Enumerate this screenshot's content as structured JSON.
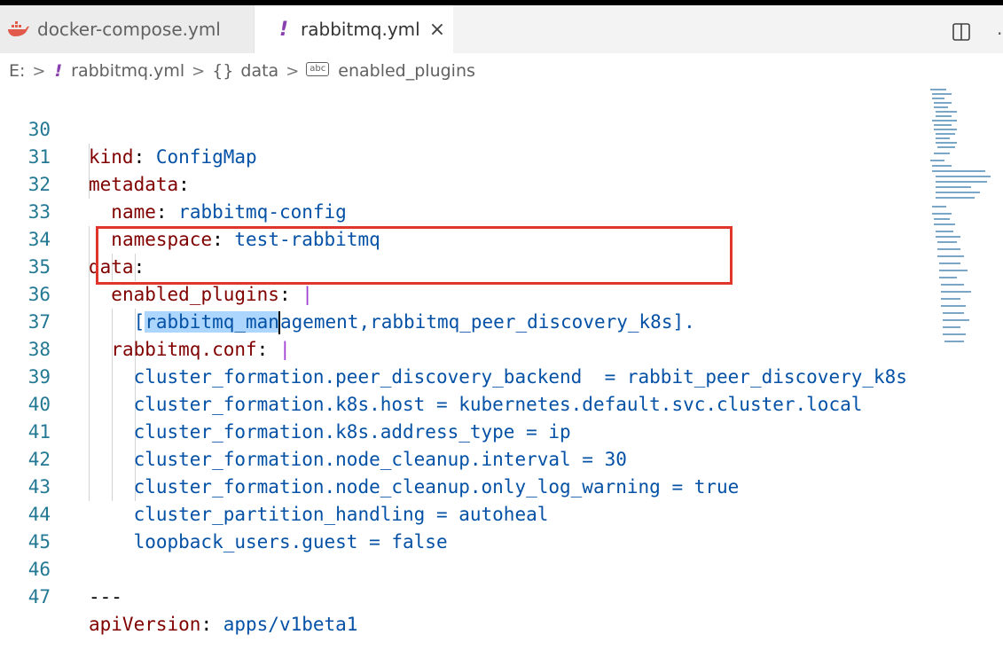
{
  "tabs": [
    {
      "label": "docker-compose.yml",
      "icon": "docker-whale-icon",
      "active": false
    },
    {
      "label": "rabbitmq.yml",
      "icon": "yaml-exclamation-icon",
      "active": true,
      "close": "×"
    }
  ],
  "breadcrumb": {
    "drive": "E:",
    "file": "rabbitmq.yml",
    "braces": "{}",
    "node1": "data",
    "node2": "enabled_plugins"
  },
  "lines": [
    {
      "num": "30",
      "key": "kind",
      "sep": ": ",
      "value": "ConfigMap"
    },
    {
      "num": "31",
      "key": "metadata",
      "sep": ":"
    },
    {
      "num": "32",
      "indent": "  ",
      "key": "name",
      "sep": ": ",
      "value": "rabbitmq-config"
    },
    {
      "num": "33",
      "indent": "  ",
      "key": "namespace",
      "sep": ": ",
      "value": "test-rabbitmq"
    },
    {
      "num": "34",
      "key": "data",
      "sep": ":"
    },
    {
      "num": "35",
      "indent": "  ",
      "key": "enabled_plugins",
      "sep": ": ",
      "pipe": "|"
    },
    {
      "num": "36",
      "text_sel": "rabbitmq_man",
      "text_rest": "agement,rabbitmq_peer_discovery_k8s].",
      "open": "["
    },
    {
      "num": "37",
      "indent": "  ",
      "key": "rabbitmq.conf",
      "sep": ": ",
      "pipe": "|"
    },
    {
      "num": "38",
      "text": "cluster_formation.peer_discovery_backend  = rabbit_peer_discovery_k8s"
    },
    {
      "num": "39",
      "text": "cluster_formation.k8s.host = kubernetes.default.svc.cluster.local"
    },
    {
      "num": "40",
      "text": "cluster_formation.k8s.address_type = ip"
    },
    {
      "num": "41",
      "text": "cluster_formation.node_cleanup.interval = 30"
    },
    {
      "num": "42",
      "text": "cluster_formation.node_cleanup.only_log_warning = true"
    },
    {
      "num": "43",
      "text": "cluster_partition_handling = autoheal"
    },
    {
      "num": "44",
      "text": "loopback_users.guest = false"
    },
    {
      "num": "45",
      "text": ""
    },
    {
      "num": "46",
      "text": "---"
    },
    {
      "num": "47",
      "key": "apiVersion",
      "sep": ": ",
      "value": "apps/v1beta1"
    }
  ],
  "colors": {
    "key": "#800000",
    "value": "#0451a5",
    "line_number": "#237893",
    "selection": "#add6ff",
    "box": "#e0352b"
  }
}
